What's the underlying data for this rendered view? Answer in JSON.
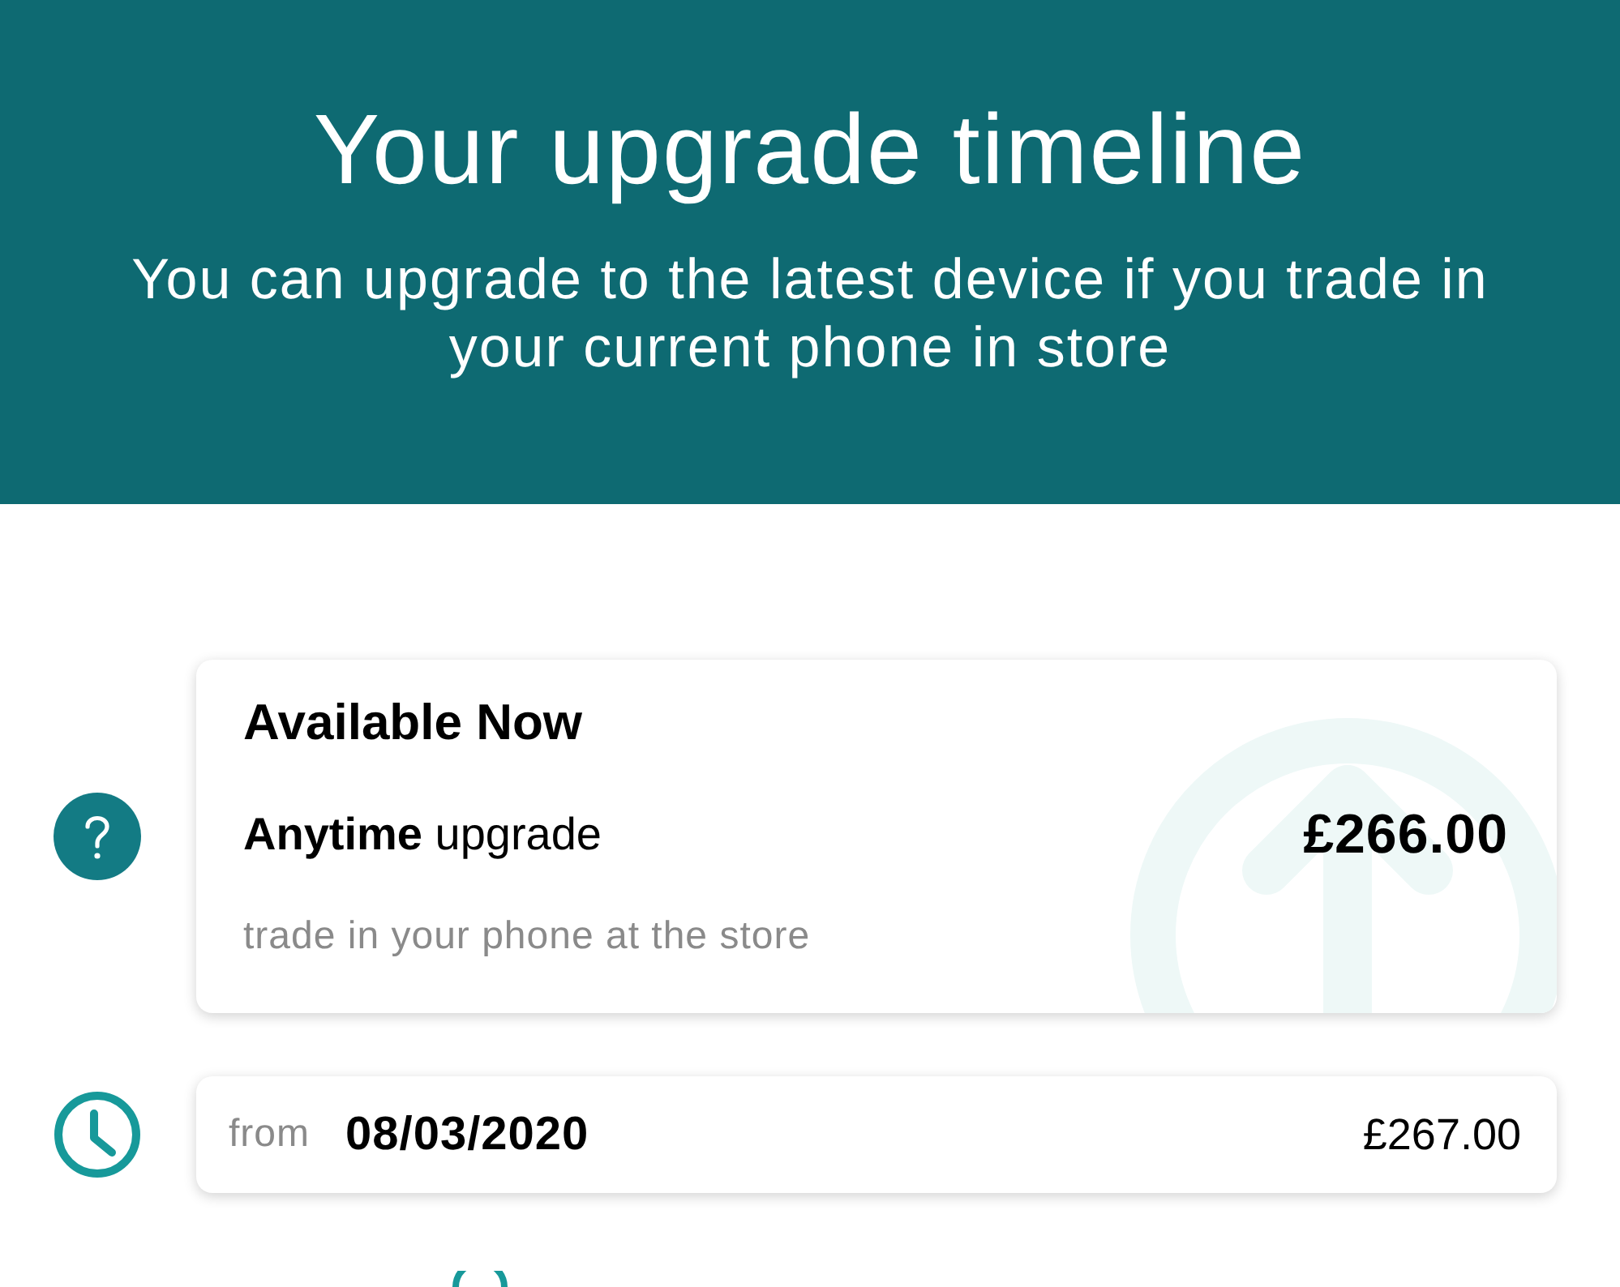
{
  "header": {
    "title": "Your upgrade timeline",
    "subtitle": "You can upgrade to the latest device if you trade in your current phone in store"
  },
  "timeline": [
    {
      "kind": "option",
      "heading": "Available Now",
      "label": "**Anytime** upgrade",
      "note": "trade in your phone at the store",
      "price": "£266.00"
    },
    {
      "kind": "date",
      "prefix": "from",
      "date": "08/03/2020",
      "price": "£267.00"
    }
  ]
}
